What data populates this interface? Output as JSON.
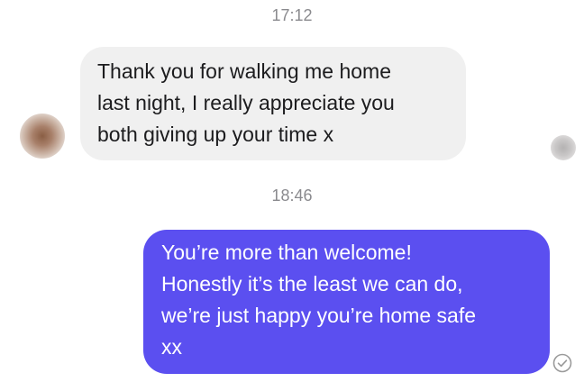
{
  "conversation": {
    "timestamps": [
      "17:12",
      "18:46"
    ],
    "incoming_message": {
      "text": "Thank you for walking me home\nlast night, I really appreciate you\nboth giving up your time x"
    },
    "outgoing_message": {
      "text": "You’re more than welcome!\nHonestly it’s the least we can do,\nwe’re just happy you’re home safe\nxx",
      "bubble_color": "#5b4ff0"
    },
    "incoming_bubble_color": "#f0f0f0",
    "status_icon": "sent-check-icon"
  }
}
